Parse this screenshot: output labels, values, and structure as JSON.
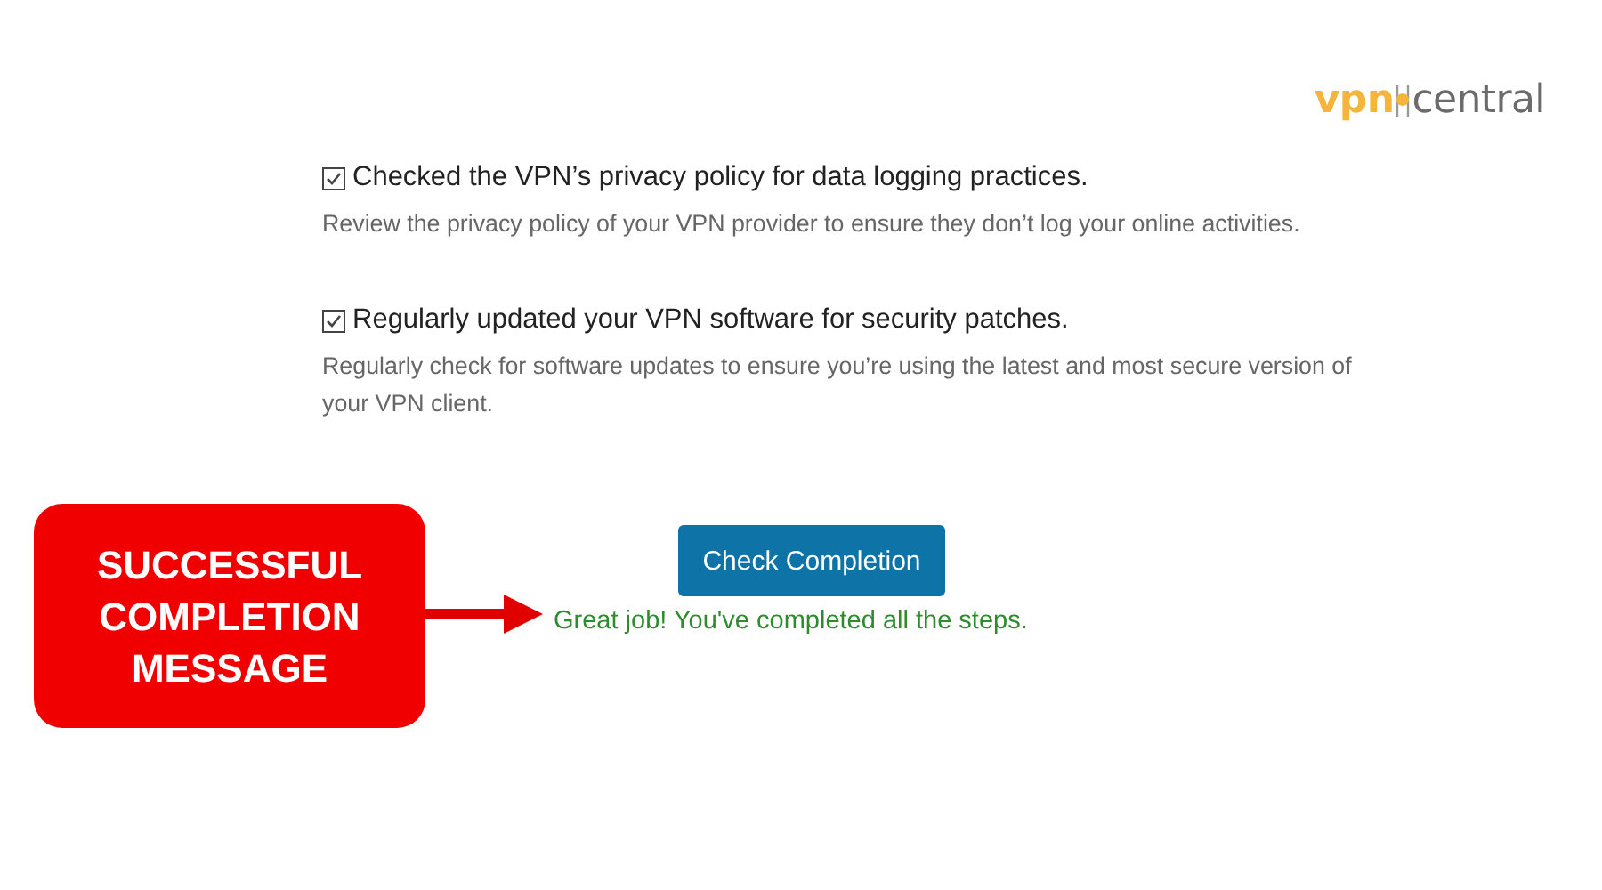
{
  "logo": {
    "brand": "vpn",
    "name": "central"
  },
  "checklist": [
    {
      "title": "Checked the VPN’s privacy policy for data logging practices.",
      "checked": true,
      "description": "Review the privacy policy of your VPN provider to ensure they don’t log your online activities."
    },
    {
      "title": "Regularly updated your VPN software for security patches.",
      "checked": true,
      "description": "Regularly check for software updates to ensure you’re using the latest and most secure version of your VPN client."
    }
  ],
  "button": {
    "label": "Check Completion"
  },
  "message": "Great job! You've completed all the steps.",
  "callout": {
    "text": "SUCCESSFUL COMPLETION MESSAGE"
  }
}
